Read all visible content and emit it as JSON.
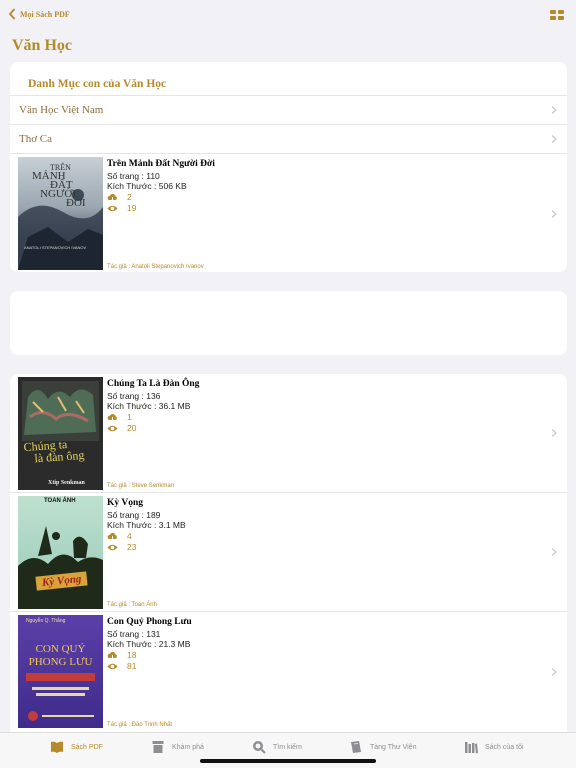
{
  "nav": {
    "back_label": "Mọi Sách PDF",
    "title": "Văn Học"
  },
  "subcategories": {
    "header": "Danh Mục con của Văn Học",
    "items": [
      {
        "label": "Văn Học Việt Nam"
      },
      {
        "label": "Thơ Ca"
      }
    ]
  },
  "books": [
    {
      "title": "Trên Mảnh Đất Người Đời",
      "pages": "Số trang : 110",
      "size": "Kích Thước : 506 KB",
      "downloads": "2",
      "views": "19",
      "author": "Tác giả : Anatoli Stepanovich Ivanov",
      "cover_text": [
        "TRÊN",
        "MẢNH",
        "ĐẤT",
        "NGƯỜI",
        "ĐỜI"
      ],
      "cover_author": "ANATOLI STEPANOVICH IVANOV"
    },
    {
      "title": "Chúng Ta Là Đàn Ông",
      "pages": "Số trang : 136",
      "size": "Kích Thước : 36.1 MB",
      "downloads": "1",
      "views": "20",
      "author": "Tác giả : Steve Senkman",
      "cover_text": [
        "Chúng ta",
        "là đàn ông"
      ],
      "cover_author": "Xtip Senkman"
    },
    {
      "title": "Kỳ Vọng",
      "pages": "Số trang : 189",
      "size": "Kích Thước : 3.1 MB",
      "downloads": "4",
      "views": "23",
      "author": "Tác giả : Toan Ánh",
      "cover_text": [
        "Kỳ Vọng"
      ],
      "cover_author": "TOAN ÁNH"
    },
    {
      "title": "Con Quỷ Phong Lưu",
      "pages": "Số trang : 131",
      "size": "Kích Thước : 21.3 MB",
      "downloads": "18",
      "views": "81",
      "author": "Tác giả : Đào Trinh Nhất",
      "cover_text": [
        "CON QUỶ",
        "PHONG LƯU"
      ],
      "cover_author": "Nguyễn Q. Thắng"
    }
  ],
  "tabs": [
    {
      "label": "Sách PDF",
      "icon": "book-open-icon",
      "active": true
    },
    {
      "label": "Khám phá",
      "icon": "archive-box-icon",
      "active": false
    },
    {
      "label": "Tìm kiếm",
      "icon": "search-icon",
      "active": false
    },
    {
      "label": "Tàng Thư Viện",
      "icon": "bookshelf-icon",
      "active": false
    },
    {
      "label": "Sách của tôi",
      "icon": "library-icon",
      "active": false
    }
  ],
  "colors": {
    "accent": "#b48a2c",
    "background": "#f2f1f6",
    "card": "#ffffff"
  }
}
